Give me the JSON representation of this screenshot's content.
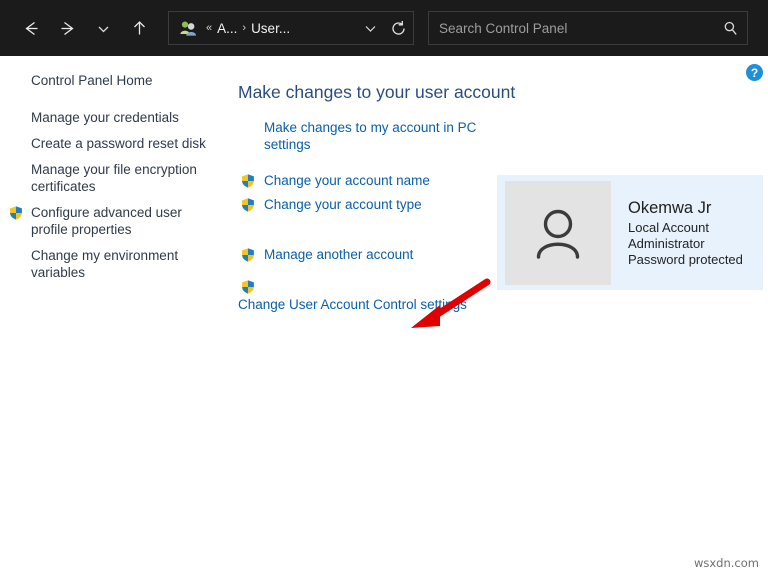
{
  "titlebar": {
    "nav": {
      "back_label": "Back",
      "forward_label": "Forward",
      "recent_label": "Recent locations",
      "up_label": "Up"
    },
    "address": {
      "icon_name": "user-accounts-icon",
      "overflow": "«",
      "separator": "›",
      "crumb1": "A...",
      "crumb2": "User...",
      "dropdown_label": "∨",
      "refresh_label": "Refresh"
    },
    "search": {
      "placeholder": "Search Control Panel",
      "value": ""
    }
  },
  "help": {
    "label": "?"
  },
  "sidebar": {
    "home": "Control Panel Home",
    "items": [
      {
        "label": "Manage your credentials",
        "shield": false
      },
      {
        "label": "Create a password reset disk",
        "shield": false
      },
      {
        "label": "Manage your file encryption certificates",
        "shield": false
      },
      {
        "label": "Configure advanced user profile properties",
        "shield": true
      },
      {
        "label": "Change my environment variables",
        "shield": false
      }
    ]
  },
  "main": {
    "title": "Make changes to your user account",
    "links": [
      {
        "label": "Make changes to my account in PC settings",
        "shield": false
      },
      {
        "label": "Change your account name",
        "shield": true
      },
      {
        "label": "Change your account type",
        "shield": true
      }
    ],
    "links_lower": [
      {
        "label": "Manage another account",
        "shield": true
      }
    ],
    "link_stacked": {
      "label": "Change User Account Control settings",
      "shield": true
    }
  },
  "account": {
    "avatar_name": "user-avatar-icon",
    "name": "Okemwa Jr",
    "type": "Local Account",
    "role": "Administrator",
    "password": "Password protected"
  },
  "annotation": {
    "arrow_name": "red-arrow-annotation",
    "color": "#e00000"
  },
  "watermark": "wsxdn.com",
  "colors": {
    "titlebar_bg": "#1b1b1b",
    "link_blue": "#0a5fa8",
    "heading_blue": "#2a4d7e",
    "panel_blue": "#e7f2fc",
    "accent_red": "#e00000",
    "help_blue": "#1f8fd8"
  }
}
